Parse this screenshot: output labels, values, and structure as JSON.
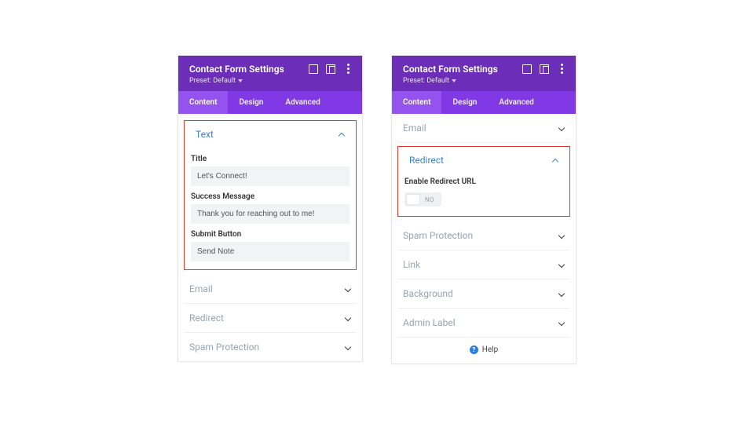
{
  "header": {
    "title": "Contact Form Settings",
    "preset_label": "Preset: Default"
  },
  "tabs": {
    "content": "Content",
    "design": "Design",
    "advanced": "Advanced"
  },
  "panel1": {
    "text_section": {
      "heading": "Text",
      "title_label": "Title",
      "title_value": "Let's Connect!",
      "success_label": "Success Message",
      "success_value": "Thank you for reaching out to me!",
      "submit_label": "Submit Button",
      "submit_value": "Send Note"
    },
    "collapsed": {
      "email": "Email",
      "redirect": "Redirect",
      "spam": "Spam Protection"
    }
  },
  "panel2": {
    "email_heading": "Email",
    "redirect_section": {
      "heading": "Redirect",
      "enable_label": "Enable Redirect URL",
      "toggle_state": "NO"
    },
    "collapsed": {
      "spam": "Spam Protection",
      "link": "Link",
      "background": "Background",
      "admin": "Admin Label"
    },
    "help_label": "Help"
  }
}
